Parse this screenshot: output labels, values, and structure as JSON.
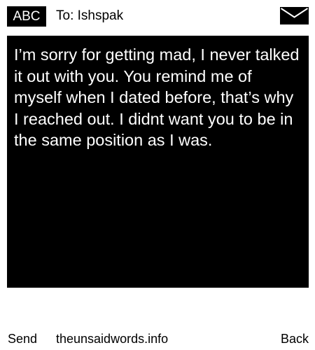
{
  "header": {
    "badge_label": "ABC",
    "to_label": "To: Ishspak",
    "envelope_icon": "envelope-icon"
  },
  "message": {
    "text": "I’m sorry for getting mad, I never talked it out with you. You remind me of myself when I dated before, that’s why I reached out. I didnt want you to be in the same position as I was."
  },
  "footer": {
    "send_label": "Send",
    "site_label": "theunsaidwords.info",
    "back_label": "Back"
  },
  "colors": {
    "background": "#ffffff",
    "message_background": "#000000",
    "message_text": "#ffffff",
    "text": "#000000"
  }
}
